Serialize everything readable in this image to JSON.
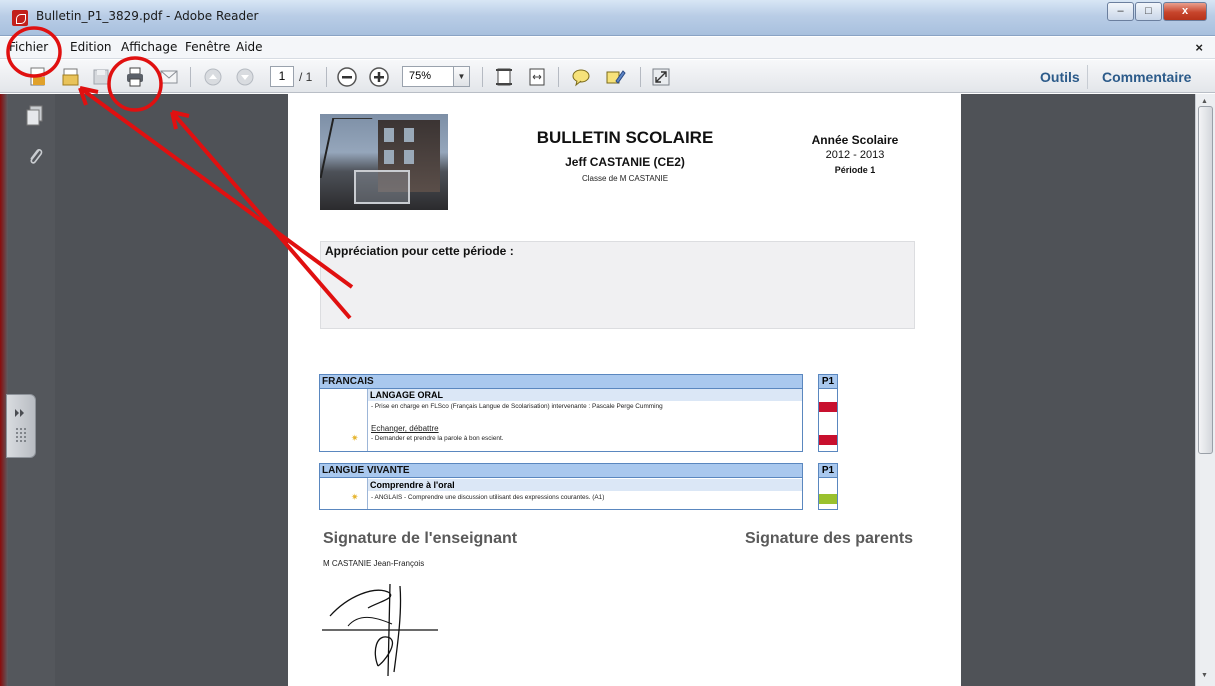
{
  "window": {
    "title": "Bulletin_P1_3829.pdf - Adobe Reader",
    "controls": {
      "minimize": "–",
      "maximize": "□",
      "close": "x"
    }
  },
  "menu": {
    "items": [
      "Fichier",
      "Edition",
      "Affichage",
      "Fenêtre",
      "Aide"
    ],
    "close": "×"
  },
  "toolbar": {
    "page_current": "1",
    "page_total": "/ 1",
    "zoom": "75%",
    "zoom_dropdown": "▼",
    "tools_label": "Outils",
    "comment_label": "Commentaire"
  },
  "document": {
    "title": "BULLETIN SCOLAIRE",
    "student": "Jeff CASTANIE (CE2)",
    "class": "Classe de M CASTANIE",
    "year_label": "Année Scolaire",
    "year": "2012 - 2013",
    "period": "Période 1",
    "appreciation_label": "Appréciation pour cette période :",
    "sections": [
      {
        "name": "FRANCAIS",
        "level": "LANGAGE ORAL",
        "lines": [
          "- Prise en charge en FLSco (Français Langue de Scolarisation) intervenante : Pascale Perge Cumming",
          "- Demander et prendre la parole à bon escient."
        ],
        "sub": "Echanger, débattre",
        "period_col": "P1",
        "marks": [
          "#c8102e",
          "#ffffff",
          "#c8102e"
        ]
      },
      {
        "name": "LANGUE VIVANTE",
        "level": "Comprendre à  l'oral",
        "lines": [
          "- ANGLAIS - Comprendre une discussion utilisant des expressions courantes. (A1)"
        ],
        "period_col": "P1",
        "marks": [
          "#ffffff",
          "#9ac12e"
        ]
      }
    ],
    "signature_teacher_label": "Signature de l'enseignant",
    "signature_parents_label": "Signature des parents",
    "teacher_name": "M CASTANIE Jean-François"
  },
  "colors": {
    "annotation": "#e01010",
    "section_header": "#a9c8ee",
    "link": "#2c5b8a"
  },
  "icons": [
    "create-pdf-icon",
    "open-icon",
    "save-icon",
    "print-icon",
    "email-icon",
    "page-up-icon",
    "page-down-icon",
    "zoom-out-icon",
    "zoom-in-icon",
    "fit-page-icon",
    "fit-width-icon",
    "comment-icon",
    "highlight-icon",
    "fullscreen-icon",
    "pages-panel-icon",
    "attachments-icon"
  ]
}
